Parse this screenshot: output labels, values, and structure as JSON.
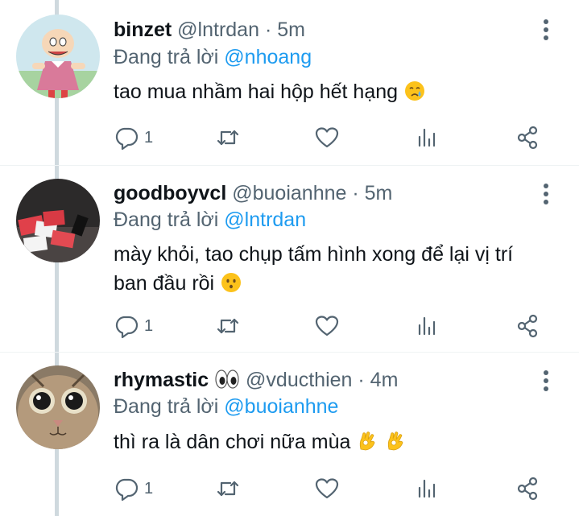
{
  "reply_prefix": "Đang trả lời",
  "tweets": [
    {
      "name": "binzet",
      "handle": "@lntrdan",
      "sep": "·",
      "time": "5m",
      "reply_to": "@nhoang",
      "text": "tao mua nhầm hai hộp hết hạng",
      "emoji": "crying-face",
      "reply_count": "1"
    },
    {
      "name": "goodboyvcl",
      "handle": "@buoianhne",
      "sep": "·",
      "time": "5m",
      "reply_to": "@lntrdan",
      "text_line1": "mày khỏi, tao chụp tấm hình xong để lại vị trí",
      "text_line2": "ban đầu rồi",
      "emoji": "hushed-face",
      "reply_count": "1"
    },
    {
      "name": "rhymastic",
      "name_emoji": "eyes",
      "handle": "@vducthien",
      "sep": "·",
      "time": "4m",
      "reply_to": "@buoianhne",
      "text": "thì ra là dân chơi nữa mùa",
      "emoji": "ok-hand-x2",
      "reply_count": "1"
    }
  ],
  "colors": {
    "link": "#1d9bf0",
    "muted": "#536471",
    "text": "#0f1419",
    "thread_line": "#cfd9de"
  }
}
